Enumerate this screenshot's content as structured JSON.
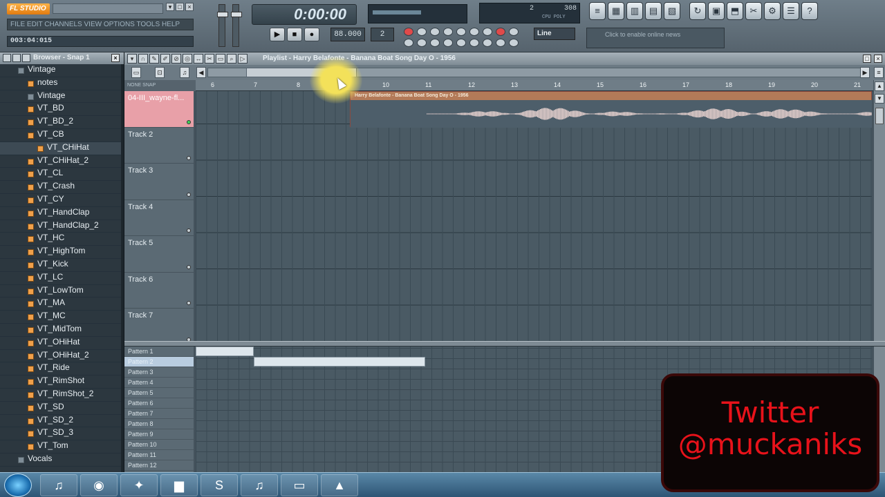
{
  "app": {
    "logo_text": "FL STUDIO",
    "hint_text": "FILE EDIT CHANNELS VIEW OPTIONS TOOLS HELP",
    "time_info": "003:04:015",
    "song_time": "0:00:00",
    "pattern_number": "2",
    "snap_mode": "Line",
    "cpu_value": "2",
    "poly_value": "308",
    "cpu_label": "CPU POLY",
    "browser_link_text": "Click to enable online news",
    "accent_color": "#f0a04a"
  },
  "browser": {
    "title": "Browser - Snap 1",
    "items": [
      {
        "label": "Vintage",
        "type": "folder",
        "indent": 1
      },
      {
        "label": "notes",
        "type": "text",
        "indent": 2
      },
      {
        "label": "Vintage",
        "type": "folder",
        "indent": 2
      },
      {
        "label": "VT_BD",
        "type": "sample",
        "indent": 2
      },
      {
        "label": "VT_BD_2",
        "type": "sample",
        "indent": 2
      },
      {
        "label": "VT_CB",
        "type": "sample",
        "indent": 2
      },
      {
        "label": "VT_CHiHat",
        "type": "sample",
        "indent": 3,
        "selected": true
      },
      {
        "label": "VT_CHiHat_2",
        "type": "sample",
        "indent": 2
      },
      {
        "label": "VT_CL",
        "type": "sample",
        "indent": 2
      },
      {
        "label": "VT_Crash",
        "type": "sample",
        "indent": 2
      },
      {
        "label": "VT_CY",
        "type": "sample",
        "indent": 2
      },
      {
        "label": "VT_HandClap",
        "type": "sample",
        "indent": 2
      },
      {
        "label": "VT_HandClap_2",
        "type": "sample",
        "indent": 2
      },
      {
        "label": "VT_HC",
        "type": "sample",
        "indent": 2
      },
      {
        "label": "VT_HighTom",
        "type": "sample",
        "indent": 2
      },
      {
        "label": "VT_Kick",
        "type": "sample",
        "indent": 2
      },
      {
        "label": "VT_LC",
        "type": "sample",
        "indent": 2
      },
      {
        "label": "VT_LowTom",
        "type": "sample",
        "indent": 2
      },
      {
        "label": "VT_MA",
        "type": "sample",
        "indent": 2
      },
      {
        "label": "VT_MC",
        "type": "sample",
        "indent": 2
      },
      {
        "label": "VT_MidTom",
        "type": "sample",
        "indent": 2
      },
      {
        "label": "VT_OHiHat",
        "type": "sample",
        "indent": 2
      },
      {
        "label": "VT_OHiHat_2",
        "type": "sample",
        "indent": 2
      },
      {
        "label": "VT_Ride",
        "type": "sample",
        "indent": 2
      },
      {
        "label": "VT_RimShot",
        "type": "sample",
        "indent": 2
      },
      {
        "label": "VT_RimShot_2",
        "type": "sample",
        "indent": 2
      },
      {
        "label": "VT_SD",
        "type": "sample",
        "indent": 2
      },
      {
        "label": "VT_SD_2",
        "type": "sample",
        "indent": 2
      },
      {
        "label": "VT_SD_3",
        "type": "sample",
        "indent": 2
      },
      {
        "label": "VT_Tom",
        "type": "sample",
        "indent": 2
      },
      {
        "label": "Vocals",
        "type": "folder",
        "indent": 1
      }
    ]
  },
  "playlist": {
    "title": "Playlist - Harry Belafonte - Banana Boat Song Day O - 1956",
    "ruler_left_label": "NONE  SNAP",
    "bar_labels": [
      "6",
      "7",
      "8",
      "9",
      "10",
      "11",
      "12",
      "13",
      "14",
      "15",
      "16",
      "17",
      "18",
      "19",
      "20",
      "21"
    ],
    "tracks": [
      {
        "name": "04-III_wayne-fl..."
      },
      {
        "name": "Track 2"
      },
      {
        "name": "Track 3"
      },
      {
        "name": "Track 4"
      },
      {
        "name": "Track 5"
      },
      {
        "name": "Track 6"
      },
      {
        "name": "Track 7"
      }
    ],
    "clip_title": "Harry Belafonte - Banana Boat Song Day O - 1956",
    "patterns": [
      "Pattern 1",
      "Pattern 2",
      "Pattern 3",
      "Pattern 4",
      "Pattern 5",
      "Pattern 6",
      "Pattern 7",
      "Pattern 8",
      "Pattern 9",
      "Pattern 10",
      "Pattern 11",
      "Pattern 12"
    ],
    "selected_pattern": "Pattern 2"
  },
  "overlay": {
    "line1": "Twitter",
    "line2": "@muckaniks",
    "text_color": "#e8121a"
  },
  "taskbar": {
    "apps": [
      {
        "name": "iTunes",
        "icon": "music-note-icon"
      },
      {
        "name": "Chrome",
        "icon": "chrome-icon"
      },
      {
        "name": "FL Studio",
        "icon": "fl-studio-icon"
      },
      {
        "name": "Explorer",
        "icon": "folder-icon"
      },
      {
        "name": "Skype",
        "icon": "skype-icon"
      },
      {
        "name": "iTunes 2",
        "icon": "music-note-icon"
      },
      {
        "name": "Notes",
        "icon": "sticky-note-icon"
      },
      {
        "name": "Recorder",
        "icon": "recorder-icon"
      }
    ]
  }
}
